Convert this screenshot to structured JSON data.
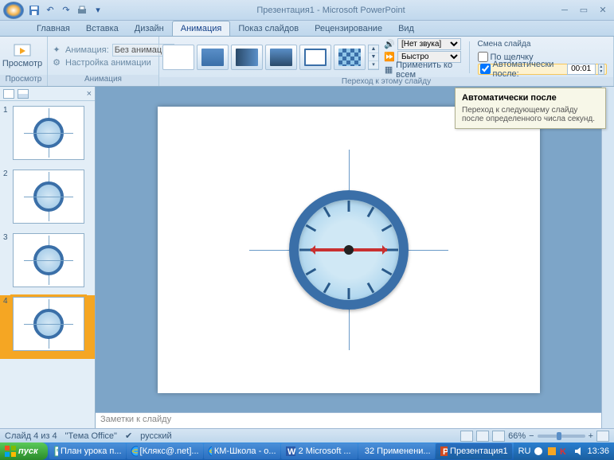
{
  "title": "Презентация1 - Microsoft PowerPoint",
  "qat": {
    "save": "💾",
    "undo": "↶",
    "redo": "↷",
    "print": "🖨",
    "more": "▾"
  },
  "tabs": [
    "Главная",
    "Вставка",
    "Дизайн",
    "Анимация",
    "Показ слайдов",
    "Рецензирование",
    "Вид"
  ],
  "active_tab": "Анимация",
  "ribbon": {
    "preview": {
      "label": "Просмотр",
      "group": "Просмотр"
    },
    "animation": {
      "anim_label": "Анимация:",
      "anim_value": "Без анимац...",
      "settings": "Настройка анимации",
      "group": "Анимация"
    },
    "transition": {
      "sound_label": "[Нет звука]",
      "speed_label": "Быстро",
      "apply_all": "Применить ко всем",
      "group": "Переход к этому слайду"
    },
    "advance": {
      "title": "Смена слайда",
      "on_click": "По щелчку",
      "auto_after": "Автоматически после:",
      "time": "00:01",
      "on_click_checked": false,
      "auto_checked": true
    }
  },
  "tooltip": {
    "title": "Автоматически после",
    "body": "Переход к следующему слайду после определенного числа секунд."
  },
  "thumbs": [
    1,
    2,
    3,
    4
  ],
  "selected_thumb": 4,
  "notes_placeholder": "Заметки к слайду",
  "status": {
    "slide": "Слайд 4 из 4",
    "theme": "\"Тема Office\"",
    "lang": "русский",
    "zoom": "66%"
  },
  "taskbar": {
    "start": "пуск",
    "items": [
      {
        "label": "План урока п...",
        "icon": "doc"
      },
      {
        "label": "[Клякс@.net]...",
        "icon": "ie"
      },
      {
        "label": "КМ-Школа - о...",
        "icon": "ie"
      },
      {
        "label": "2 Microsoft ...",
        "icon": "word"
      },
      {
        "label": "32 Применени...",
        "icon": "folder"
      },
      {
        "label": "Презентация1",
        "icon": "ppt",
        "active": true
      }
    ],
    "lang_ind": "RU",
    "time": "13:36"
  }
}
